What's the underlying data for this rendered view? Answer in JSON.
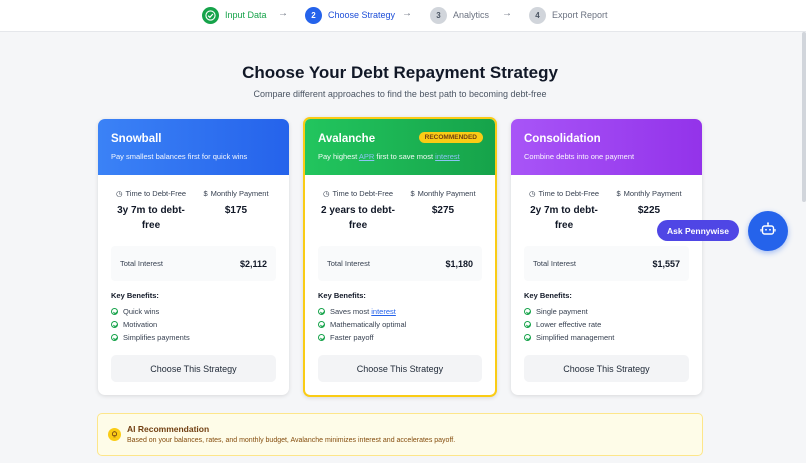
{
  "stepper": {
    "steps": [
      {
        "number": "1",
        "label": "Input Data",
        "state": "done"
      },
      {
        "number": "2",
        "label": "Choose Strategy",
        "state": "active"
      },
      {
        "number": "3",
        "label": "Analytics",
        "state": "idle"
      },
      {
        "number": "4",
        "label": "Export Report",
        "state": "idle"
      }
    ],
    "arrow": "→"
  },
  "header": {
    "title": "Choose Your Debt Repayment Strategy",
    "subtitle": "Compare different approaches to find the best path to becoming debt-free"
  },
  "labels": {
    "time_label": "Time to Debt-Free",
    "payment_label": "Monthly Payment",
    "interest_label": "Total Interest",
    "benefits_title": "Key Benefits:",
    "choose_button": "Choose This Strategy"
  },
  "strategies": [
    {
      "name": "Snowball",
      "description": "Pay smallest balances first for quick wins",
      "time": "3y 7m to debt-free",
      "payment": "$175",
      "interest": "$2,112",
      "benefits": [
        "Quick wins",
        "Motivation",
        "Simplifies payments"
      ],
      "color": "#2563eb"
    },
    {
      "name": "Avalanche",
      "badge": "RECOMMENDED",
      "description_parts": [
        "Pay highest ",
        "APR",
        " first to save most ",
        "interest"
      ],
      "time": "2 years to debt-free",
      "payment": "$275",
      "interest": "$1,180",
      "benefits": [
        "Saves most ",
        "interest",
        "Mathematically optimal",
        "Faster payoff"
      ],
      "color": "#16a34a"
    },
    {
      "name": "Consolidation",
      "description": "Combine debts into one payment",
      "time": "2y 7m to debt-free",
      "payment": "$225",
      "interest": "$1,557",
      "benefits": [
        "Single payment",
        "Lower effective rate",
        "Simplified management"
      ],
      "color": "#9333ea"
    }
  ],
  "assistant": {
    "label": "Ask Pennywise",
    "icon": "robot-icon"
  },
  "ai_recommendation": {
    "title": "AI Recommendation",
    "text": "Based on your balances, rates, and monthly budget, Avalanche minimizes interest and accelerates payoff.",
    "icon": "lightbulb-icon"
  }
}
